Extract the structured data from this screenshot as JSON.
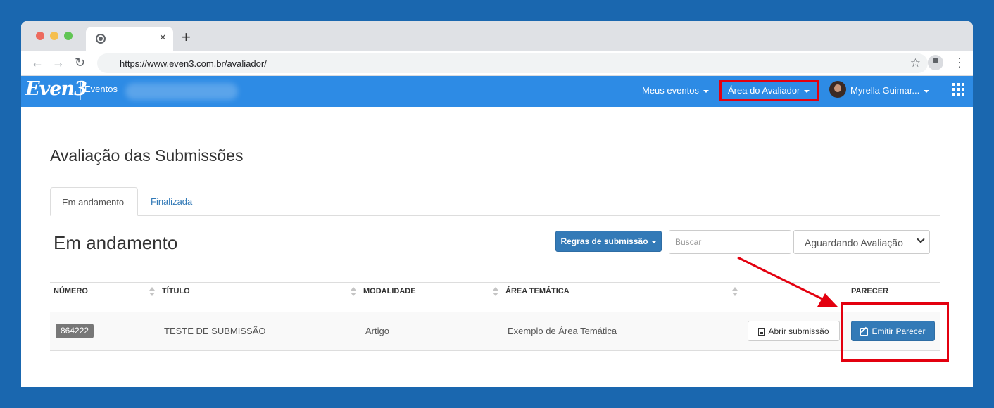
{
  "browser": {
    "url": "https://www.even3.com.br/avaliador/",
    "new_tab": "+",
    "tab_close": "×"
  },
  "navbar": {
    "logo": "Even3",
    "brand_link": "Eventos",
    "meus_eventos": "Meus eventos",
    "area_avaliador": "Área do Avaliador",
    "user_name": "Myrella Guimar..."
  },
  "page": {
    "title": "Avaliação das Submissões",
    "tabs": [
      {
        "label": "Em andamento"
      },
      {
        "label": "Finalizada"
      }
    ],
    "section_title": "Em andamento"
  },
  "filters": {
    "rules_button": "Regras de submissão",
    "search_placeholder": "Buscar",
    "status_select": "Aguardando Avaliação"
  },
  "table": {
    "columns": [
      "NÚMERO",
      "TÍTULO",
      "MODALIDADE",
      "ÁREA TEMÁTICA",
      "PARECER"
    ],
    "rows": [
      {
        "numero": "864222",
        "titulo": "TESTE DE SUBMISSÃO",
        "modalidade": "Artigo",
        "area": "Exemplo de Área Temática",
        "abrir_label": "Abrir submissão",
        "emitir_label": "Emitir Parecer"
      }
    ]
  },
  "colors": {
    "background": "#1a67af",
    "navbar": "#2d8be5",
    "primary": "#337ab7",
    "highlight": "#e3000f"
  }
}
